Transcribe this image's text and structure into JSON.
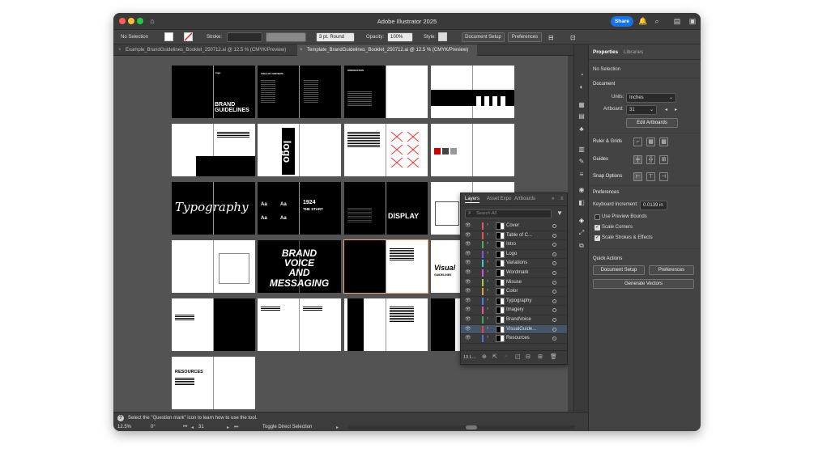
{
  "app": {
    "title": "Adobe Illustrator 2025",
    "share_label": "Share"
  },
  "control_bar": {
    "selection": "No Selection",
    "stroke_label": "Stroke:",
    "brush_value": "3 pt. Round",
    "opacity_label": "Opacity:",
    "opacity_value": "100%",
    "style_label": "Style:",
    "document_setup": "Document Setup",
    "preferences": "Preferences"
  },
  "tabs": [
    {
      "label": "Example_BrandGuidelines_Booklet_250712.ai @ 12.5 % (CMYK/Preview)"
    },
    {
      "label": "Template_BrandGuidelines_Booklet_250712.ai @ 12.5 % (CMYK/Preview)"
    }
  ],
  "artboards": {
    "cover_title": "BRAND\nGUIDELINES",
    "cover_logo": "logo",
    "toc_title": "TABLE OF CONTENTS",
    "intro_title": "INTRODUCTION",
    "logo_big": "logo",
    "typography": "Typography",
    "year": "1924",
    "the_start": "THE START",
    "display": "DISPLAY",
    "brand_voice": "BRAND\nVOICE\nAND\nMESSAGING",
    "visual": "Visual",
    "visual_sub": "GUIDELINES",
    "resources": "RESOURCES",
    "aa": "Aa"
  },
  "layers_panel": {
    "tabs": [
      "Layers",
      "Asset Expo",
      "Artboards"
    ],
    "search_placeholder": "Search All",
    "layers": [
      {
        "name": "Cover",
        "color": "#e8546b"
      },
      {
        "name": "Table of C...",
        "color": "#e84f4f"
      },
      {
        "name": "Intro",
        "color": "#4caf50"
      },
      {
        "name": "Logo",
        "color": "#8e4fe8"
      },
      {
        "name": "Variations",
        "color": "#3ec7c7"
      },
      {
        "name": "Wordmark",
        "color": "#d64fe8"
      },
      {
        "name": "Misuse",
        "color": "#9ad13c"
      },
      {
        "name": "Color",
        "color": "#e89a3c"
      },
      {
        "name": "Typography",
        "color": "#4f7be8"
      },
      {
        "name": "Imagery",
        "color": "#e84fa8"
      },
      {
        "name": "BrandVoice",
        "color": "#3ca84f"
      },
      {
        "name": "VisualGuide...",
        "color": "#e8443c",
        "selected": true
      },
      {
        "name": "Resources",
        "color": "#5a6ee8"
      }
    ],
    "footer_count": "13 L..."
  },
  "properties_panel": {
    "tabs": [
      "Properties",
      "Libraries"
    ],
    "selection": "No Selection",
    "document_head": "Document",
    "units_label": "Units:",
    "units_value": "Inches",
    "artboard_label": "Artboard:",
    "artboard_value": "31",
    "edit_artboards": "Edit Artboards",
    "ruler_grids": "Ruler & Grids",
    "guides": "Guides",
    "snap_options": "Snap Options",
    "preferences_head": "Preferences",
    "keyboard_increment_label": "Keyboard Increment:",
    "keyboard_increment_value": "0.0139 in",
    "use_preview_bounds": "Use Preview Bounds",
    "scale_corners": "Scale Corners",
    "scale_strokes": "Scale Strokes & Effects",
    "quick_actions": "Quick Actions",
    "document_setup": "Document Setup",
    "preferences": "Preferences",
    "generate_vectors": "Generate Vectors"
  },
  "status": {
    "hint": "Select the \"Question mark\" icon to learn how to use the tool.",
    "zoom": "12.5%",
    "rotation": "0°",
    "artboard": "31",
    "tool": "Toggle Direct Selection"
  }
}
